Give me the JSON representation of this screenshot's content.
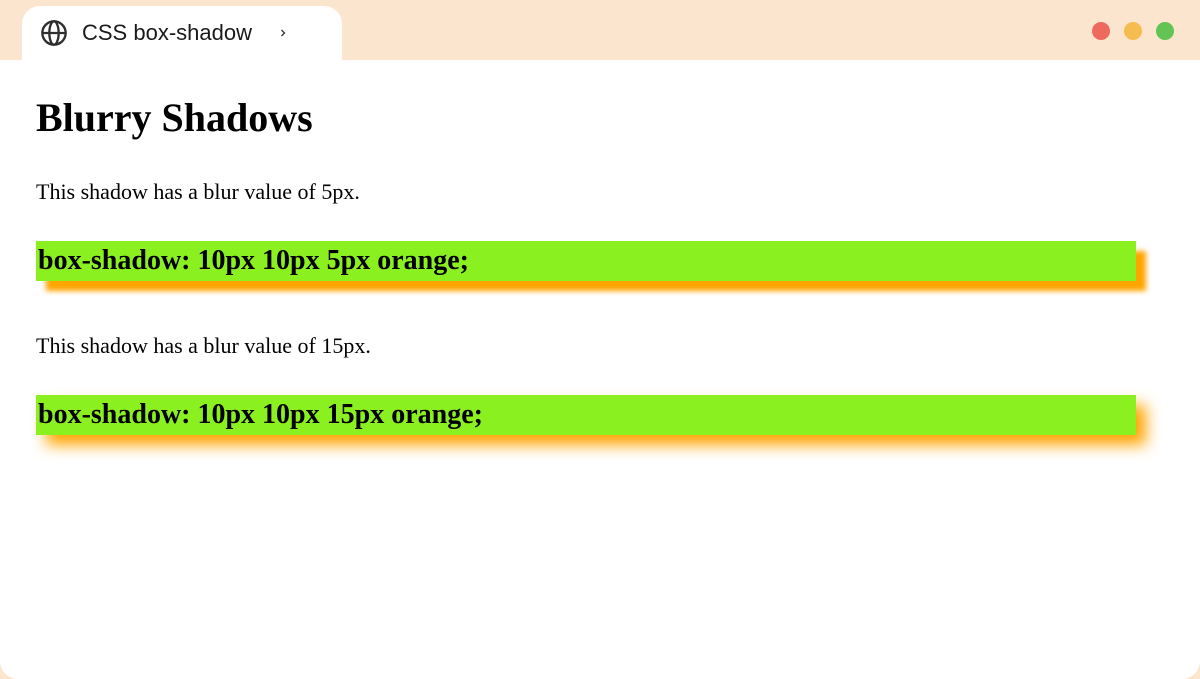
{
  "tab": {
    "title": "CSS box-shadow"
  },
  "page": {
    "heading": "Blurry Shadows"
  },
  "examples": [
    {
      "caption": "This shadow has a blur value of 5px.",
      "code": "box-shadow: 10px 10px 5px orange;",
      "shadow_class": "shadow-5"
    },
    {
      "caption": "This shadow has a blur value of 15px.",
      "code": "box-shadow: 10px 10px 15px orange;",
      "shadow_class": "shadow-15"
    }
  ],
  "colors": {
    "tab_bar_bg": "#fce5cf",
    "box_bg": "#8bf01f",
    "shadow": "orange"
  }
}
